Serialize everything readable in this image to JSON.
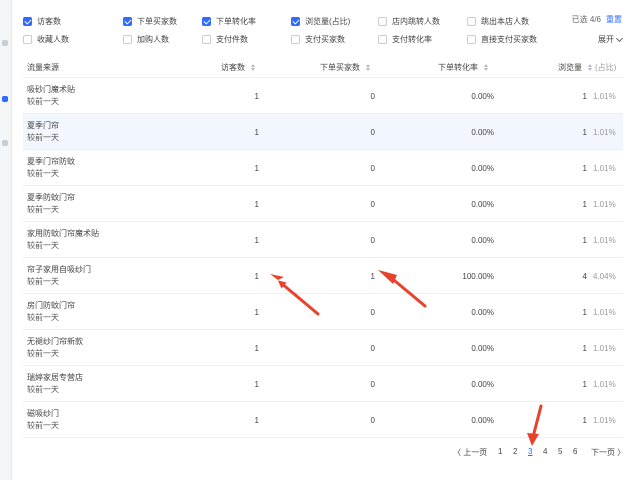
{
  "filters": {
    "row1": [
      {
        "label": "访客数",
        "checked": true
      },
      {
        "label": "下单买家数",
        "checked": true
      },
      {
        "label": "下单转化率",
        "checked": true
      },
      {
        "label": "浏览量(占比)",
        "checked": true
      },
      {
        "label": "店内跳转人数",
        "checked": false
      },
      {
        "label": "跳出本店人数",
        "checked": false
      }
    ],
    "row2": [
      {
        "label": "收藏人数",
        "checked": false
      },
      {
        "label": "加购人数",
        "checked": false
      },
      {
        "label": "支付件数",
        "checked": false
      },
      {
        "label": "支付买家数",
        "checked": false
      },
      {
        "label": "支付转化率",
        "checked": false
      },
      {
        "label": "直接支付买家数",
        "checked": false
      }
    ],
    "selected_text": "已选 4/6",
    "reset_label": "重置",
    "expand_label": "展开"
  },
  "table": {
    "headers": {
      "source": "流量来源",
      "visitors": "访客数",
      "buyers": "下单买家数",
      "conversion": "下单转化率",
      "pageviews": "浏览量",
      "share": "(占比)"
    },
    "rows": [
      {
        "source": "吸砂门魔术贴",
        "compare": "较前一天",
        "visitors": "1",
        "buyers": "0",
        "conversion": "0.00%",
        "pageviews": "1",
        "share": "1.01%",
        "highlight": false
      },
      {
        "source": "夏季门帘",
        "compare": "较前一天",
        "visitors": "1",
        "buyers": "0",
        "conversion": "0.00%",
        "pageviews": "1",
        "share": "1.01%",
        "highlight": true
      },
      {
        "source": "夏季门帘防蚊",
        "compare": "较前一天",
        "visitors": "1",
        "buyers": "0",
        "conversion": "0.00%",
        "pageviews": "1",
        "share": "1.01%",
        "highlight": false
      },
      {
        "source": "夏季防蚊门帘",
        "compare": "较前一天",
        "visitors": "1",
        "buyers": "0",
        "conversion": "0.00%",
        "pageviews": "1",
        "share": "1.01%",
        "highlight": false
      },
      {
        "source": "家用防蚊门帘魔术贴",
        "compare": "较前一天",
        "visitors": "1",
        "buyers": "0",
        "conversion": "0.00%",
        "pageviews": "1",
        "share": "1.01%",
        "highlight": false
      },
      {
        "source": "帘子家用自吸纱门",
        "compare": "较前一天",
        "visitors": "1",
        "buyers": "1",
        "conversion": "100.00%",
        "pageviews": "4",
        "share": "4.04%",
        "highlight": false
      },
      {
        "source": "房门防蚊门帘",
        "compare": "较前一天",
        "visitors": "1",
        "buyers": "0",
        "conversion": "0.00%",
        "pageviews": "1",
        "share": "1.01%",
        "highlight": false
      },
      {
        "source": "无褪纱门帘新款",
        "compare": "较前一天",
        "visitors": "1",
        "buyers": "0",
        "conversion": "0.00%",
        "pageviews": "1",
        "share": "1.01%",
        "highlight": false
      },
      {
        "source": "瑞婷家居专营店",
        "compare": "较前一天",
        "visitors": "1",
        "buyers": "0",
        "conversion": "0.00%",
        "pageviews": "1",
        "share": "1.01%",
        "highlight": false
      },
      {
        "source": "磁吸纱门",
        "compare": "较前一天",
        "visitors": "1",
        "buyers": "0",
        "conversion": "0.00%",
        "pageviews": "1",
        "share": "1.01%",
        "highlight": false
      }
    ]
  },
  "pagination": {
    "prev": "〈 上一页",
    "pages": [
      "1",
      "2",
      "3",
      "4",
      "5",
      "6"
    ],
    "current": "3",
    "next": "下一页 〉"
  },
  "colors": {
    "accent": "#2f6bff",
    "annotation_arrow": "#e8412c",
    "row_highlight": "#f2f7ff"
  },
  "annotations": [
    "red-arrow-visitors",
    "red-arrow-buyers",
    "red-arrow-page-3"
  ]
}
